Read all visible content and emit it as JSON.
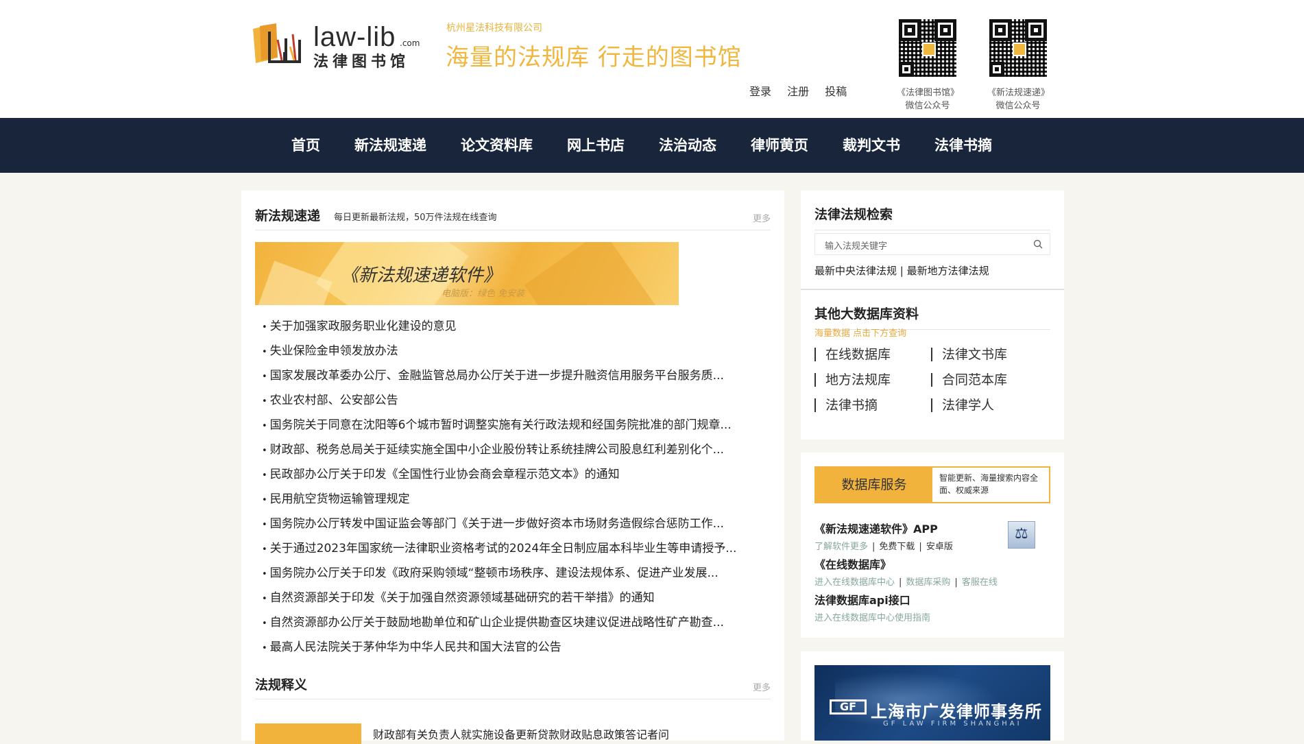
{
  "header": {
    "logo_en": "law-lib",
    "logo_com": ".com",
    "logo_cn": "法律图书馆",
    "company": "杭州星法科技有限公司",
    "slogan": "海量的法规库  行走的图书馆",
    "links": [
      "登录",
      "注册",
      "投稿"
    ],
    "qr_codes": [
      {
        "line1": "《法律图书馆》",
        "line2": "微信公众号"
      },
      {
        "line1": "《新法规速递》",
        "line2": "微信公众号"
      }
    ]
  },
  "nav": {
    "items": [
      "首页",
      "新法规速递",
      "论文资料库",
      "网上书店",
      "法治动态",
      "律师黄页",
      "裁判文书",
      "法律书摘"
    ]
  },
  "main": {
    "section1": {
      "title": "新法规速递",
      "subtitle": "每日更新最新法规，50万件法规在线查询",
      "more": "更多",
      "banner_title": "《新法规速递软件》",
      "banner_sub": "电脑版：绿色 免安装",
      "items": [
        "关于加强家政服务职业化建设的意见",
        "失业保险金申领发放办法",
        "国家发展改革委办公厅、金融监管总局办公厅关于进一步提升融资信用服务平台服务质...",
        "农业农村部、公安部公告",
        "国务院关于同意在沈阳等6个城市暂时调整实施有关行政法规和经国务院批准的部门规章...",
        "财政部、税务总局关于延续实施全国中小企业股份转让系统挂牌公司股息红利差别化个...",
        "民政部办公厅关于印发《全国性行业协会商会章程示范文本》的通知",
        "民用航空货物运输管理规定",
        "国务院办公厅转发中国证监会等部门《关于进一步做好资本市场财务造假综合惩防工作...",
        "关于通过2023年国家统一法律职业资格考试的2024年全日制应届本科毕业生等申请授予...",
        "国务院办公厅关于印发《政府采购领域“整顿市场秩序、建设法规体系、促进产业发展...",
        "自然资源部关于印发《关于加强自然资源领域基础研究的若干举措》的通知",
        "自然资源部办公厅关于鼓励地勘单位和矿山企业提供勘查区块建议促进战略性矿产勘查...",
        "最高人民法院关于茅仲华为中华人民共和国大法官的公告"
      ]
    },
    "section2": {
      "title": "法规释义",
      "more": "更多",
      "first_item": "财政部有关负责人就实施设备更新贷款财政贴息政策答记者问"
    }
  },
  "sidebar": {
    "search": {
      "title": "法律法规检索",
      "placeholder": "输入法规关键字",
      "link1": "最新中央法律法规",
      "link2": "最新地方法律法规"
    },
    "databases": {
      "title": "其他大数据库资料",
      "hint": "海量数据 点击下方查询",
      "items": [
        "在线数据库",
        "法律文书库",
        "地方法规库",
        "合同范本库",
        "法律书摘",
        "法律学人"
      ]
    },
    "service": {
      "label": "数据库服务",
      "desc": "智能更新、海量搜索内容全面、权威来源",
      "app_title": "《新法规速递软件》APP",
      "app_links": [
        "了解软件更多",
        "免费下载",
        "安卓版"
      ],
      "online_title": "《在线数据库》",
      "online_links": [
        "进入在线数据库中心",
        "数据库采购",
        "客服在线"
      ],
      "api_title": "法律数据库api接口",
      "api_link": "进入在线数据库中心使用指南"
    },
    "ad": {
      "logo": "GF",
      "name": "上海市广发律师事务所",
      "en": "GF LAW FIRM SHANGHAI"
    }
  },
  "colors": {
    "accent": "#f2b33d",
    "nav_bg": "#18253a",
    "page_bg": "#f7f5f0"
  }
}
